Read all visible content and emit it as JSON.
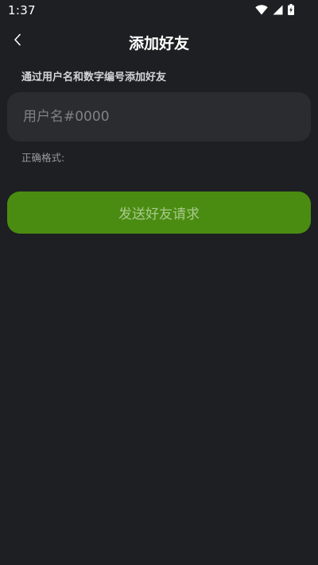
{
  "status_bar": {
    "time": "1:37"
  },
  "header": {
    "title": "添加好友",
    "back_icon": "chevron-left-icon"
  },
  "form": {
    "hint": "通过用户名和数字编号添加好友",
    "input_placeholder": "用户名#0000",
    "input_value": "",
    "format_label": "正确格式:",
    "submit_label": "发送好友请求"
  },
  "colors": {
    "background": "#1e1f22",
    "input_background": "#2b2c30",
    "button_background": "#4a8c11",
    "button_text": "#a9c98c"
  }
}
